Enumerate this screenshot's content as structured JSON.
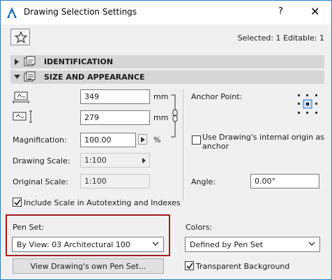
{
  "window": {
    "title": "Drawing Selection Settings",
    "help_label": "?",
    "close_label": "✕"
  },
  "status": {
    "selected_text": "Selected: 1 Editable: 1"
  },
  "sections": {
    "identification": "IDENTIFICATION",
    "size_appearance": "SIZE AND APPEARANCE"
  },
  "size": {
    "width_value": "349",
    "height_value": "279",
    "unit": "mm",
    "magnification_label": "Magnification:",
    "magnification_value": "100.00",
    "percent": "%",
    "drawing_scale_label": "Drawing Scale:",
    "drawing_scale_value": "1:100",
    "original_scale_label": "Original Scale:",
    "original_scale_value": "1:100"
  },
  "anchor": {
    "label": "Anchor Point:",
    "internal_origin_label": "Use Drawing's internal origin as",
    "internal_origin_label_2": "anchor",
    "internal_origin_checked": false,
    "angle_label": "Angle:",
    "angle_value": "0.00°"
  },
  "include_scale": {
    "label": "Include Scale in Autotexting and Indexes",
    "checked": true
  },
  "penset": {
    "label": "Pen Set:",
    "value": "By View: 03 Architectural 100",
    "view_button": "View Drawing's own Pen Set..."
  },
  "colors": {
    "label": "Colors:",
    "value": "Defined by Pen Set",
    "transparent_label": "Transparent Background",
    "transparent_checked": true
  },
  "theme": {
    "section_bg": "#d6d6d6",
    "highlight": "#a31d22",
    "accent": "#2b79c4"
  }
}
